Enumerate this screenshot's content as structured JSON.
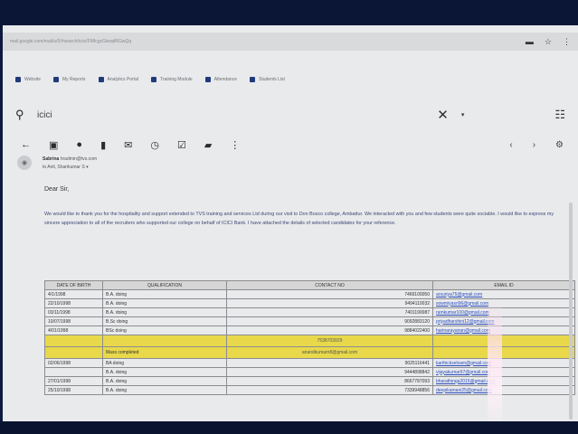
{
  "browser": {
    "url": "mail.google.com/mail/u/0/#search/icici/FMfcgzGtwqdRGwQq",
    "bookmarks": [
      {
        "label": "Website",
        "icon": "globe-icon"
      },
      {
        "label": "My Reports",
        "icon": "report-icon"
      },
      {
        "label": "Analytics Portal",
        "icon": "chart-icon"
      },
      {
        "label": "Training Module",
        "icon": "doc-icon"
      },
      {
        "label": "Attendance",
        "icon": "calendar-icon"
      },
      {
        "label": "Students List",
        "icon": "list-icon"
      }
    ]
  },
  "search": {
    "value": "icici",
    "clear_glyph": "✕",
    "caret_glyph": "▾"
  },
  "email": {
    "sender_name": "Sabrina",
    "sender_email": "hradmin@tvs.com",
    "recipient": "to Anil, Sharikumar S ▾",
    "greeting": "Dear Sir,",
    "body": "We would like to thank you for the hospitality and support extended to TVS training and services Ltd during our visit to Don Bosco college, Ambattur. We interacted with you and few students were quite sociable. I would like to express my sincere appreciation to all of the recruiters who supported our college on behalf of ICICI Bank. I have attached the details of selected candidates for your reference.",
    "table": {
      "headers": [
        "DATE OF BIRTH",
        "QUALIFICATION",
        "CONTACT NO",
        "EMAIL ID"
      ],
      "rows": [
        {
          "dob": "4/1/1998",
          "qual": "B.A. doing",
          "contact": "7469100050",
          "email": "arsuriya75@gmail.com",
          "highlight": false
        },
        {
          "dob": "22/10/1998",
          "qual": "B.A. doing",
          "contact": "9494110032",
          "email": "sowmiyasri96@gmail.com",
          "highlight": false
        },
        {
          "dob": "03/11/1998",
          "qual": "B.A. doing",
          "contact": "7401190087",
          "email": "ramkumar100@gmail.com",
          "highlight": false
        },
        {
          "dob": "10/07/1998",
          "qual": "B.Sc doing",
          "contact": "9092883120",
          "email": "priyadharshini12@gmail.com",
          "highlight": false
        },
        {
          "dob": "4/01/1998",
          "qual": "BSc doing",
          "contact": "9884022400",
          "email": "harinarayanan@gmail.com",
          "highlight": false
        },
        {
          "dob": "",
          "qual": "",
          "contact": "7538703929",
          "email": "",
          "highlight": true
        },
        {
          "dob": "",
          "qual": "Mass completed",
          "contact": "anandkumarn8@gmail.com",
          "email": "",
          "highlight": true
        },
        {
          "dob": "02/06/1998",
          "qual": "BA doing",
          "contact": "9025116441",
          "email": "karthickselvam@gmail.com",
          "highlight": false
        },
        {
          "dob": "",
          "qual": "B.A. doing",
          "contact": "9444898842",
          "email": "vijayakumar97@gmail.com",
          "highlight": false
        },
        {
          "dob": "27/01/1998",
          "qual": "B.A. doing",
          "contact": "8667787093",
          "email": "bharathiraja2015@gmail.com",
          "highlight": false
        },
        {
          "dob": "25/10/1998",
          "qual": "B.A. doing",
          "contact": "7339948856",
          "email": "deepikamani25@gmail.com",
          "highlight": false
        }
      ]
    }
  },
  "colors": {
    "highlight": "#e8d84a",
    "link": "#2c4fbf",
    "screen_bg": "#e9eaec"
  }
}
